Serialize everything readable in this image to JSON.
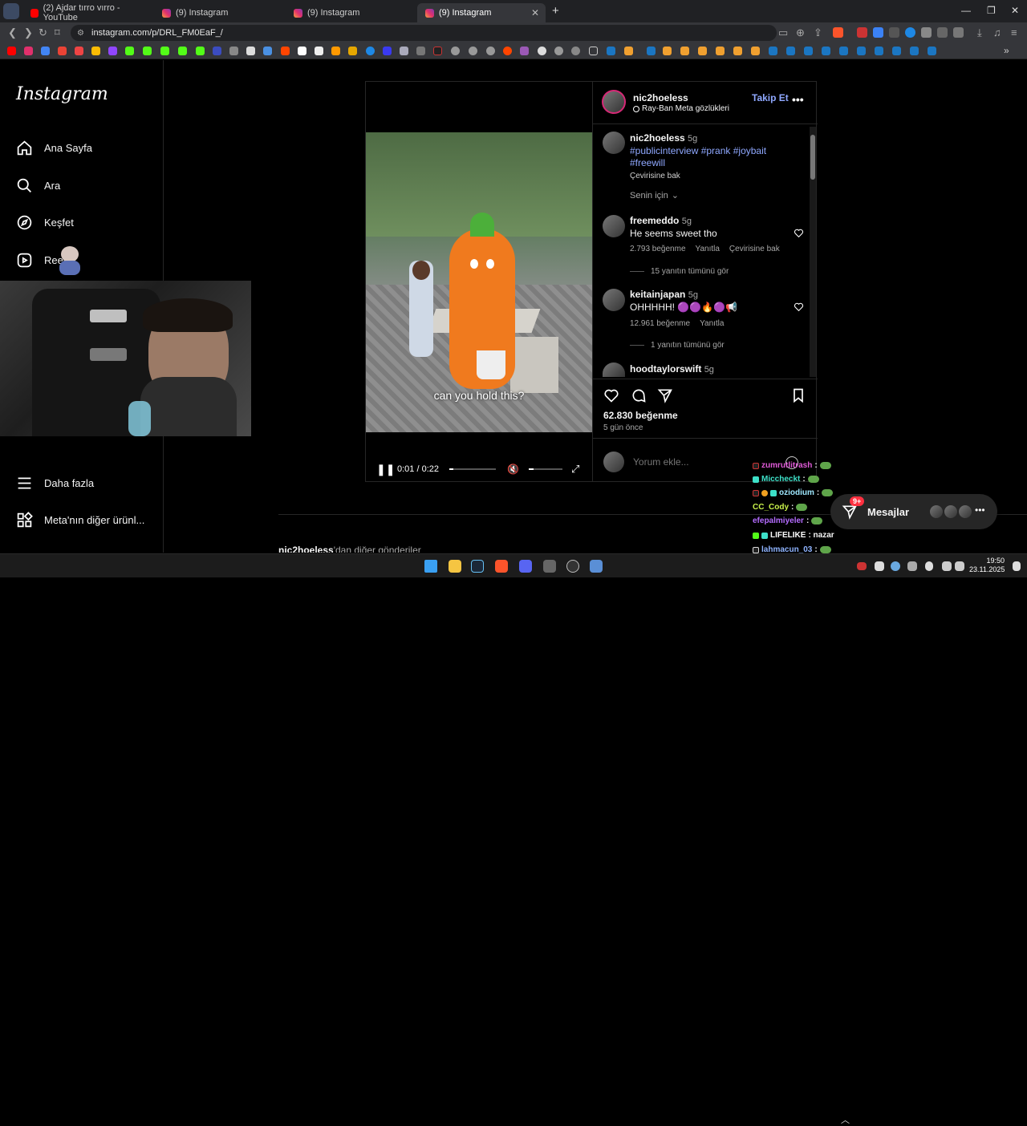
{
  "tabs": [
    {
      "title": "(2) Ajdar tırro vırro - YouTube",
      "favicon": "youtube-icon"
    },
    {
      "title": "(9) Instagram",
      "favicon": "instagram-icon"
    },
    {
      "title": "(9) Instagram",
      "favicon": "instagram-icon"
    },
    {
      "title": "(9) Instagram",
      "favicon": "instagram-icon",
      "active": true
    }
  ],
  "url": "instagram.com/p/DRL_FM0EaF_/",
  "sidebar": {
    "logo": "Instagram",
    "items": [
      {
        "label": "Ana Sayfa",
        "icon": "home-icon"
      },
      {
        "label": "Ara",
        "icon": "search-icon"
      },
      {
        "label": "Keşfet",
        "icon": "compass-icon"
      },
      {
        "label": "Reels",
        "icon": "reels-icon"
      }
    ],
    "more": "Daha fazla",
    "meta": "Meta'nın diğer ürünl..."
  },
  "post": {
    "username": "nic2hoeless",
    "location": "Ray-Ban Meta gözlükleri",
    "follow": "Takip Et",
    "caption_user": "nic2hoeless",
    "caption_time": "5g",
    "hashtags_line1": "#publicinterview #prank #joybait",
    "hashtags_line2": "#freewill",
    "translate": "Çevirisine bak",
    "sort": "Senin için",
    "video_caption": "can you hold this?",
    "time": "0:01 / 0:22",
    "likes": "62.830 beğenme",
    "posted": "5 gün önce",
    "comment_placeholder": "Yorum ekle...",
    "comments": [
      {
        "user": "freemeddo",
        "time": "5g",
        "text": "He seems sweet tho",
        "likes": "2.793 beğenme",
        "reply": "Yanıtla",
        "translate": "Çevirisine bak",
        "view_replies": "15 yanıtın tümünü gör"
      },
      {
        "user": "keitainjapan",
        "time": "5g",
        "text": "OHHHHH! 🟣🟣🔥🟣📢",
        "likes": "12.961 beğenme",
        "reply": "Yanıtla",
        "view_replies": "1 yanıtın tümünü gör"
      },
      {
        "user": "hoodtaylorswift",
        "time": "5g"
      }
    ]
  },
  "more_posts": {
    "user": "nic2hoeless",
    "suffix": "'dan diğer gönderiler"
  },
  "messages": {
    "label": "Mesajlar",
    "badge": "9+"
  },
  "chat": [
    {
      "user": "zumrutlitrash",
      "msg": ":",
      "color": "#e05bd8"
    },
    {
      "user": "Miccheckt",
      "msg": ":",
      "color": "#3de0c8"
    },
    {
      "user": "oziodium",
      "msg": ":",
      "color": "#9fe8ff"
    },
    {
      "user": "CC_Cody",
      "msg": ":",
      "color": "#c9f24a"
    },
    {
      "user": "efepalmiyeler",
      "msg": ":",
      "color": "#b46cff"
    },
    {
      "user": "LIFELIKE",
      "msg": ": nazar",
      "color": "#ffffff"
    },
    {
      "user": "lahmacun_03",
      "msg": ":",
      "color": "#8fb4ff"
    }
  ],
  "clock": {
    "time": "19:50",
    "date": "23.11.2025"
  }
}
